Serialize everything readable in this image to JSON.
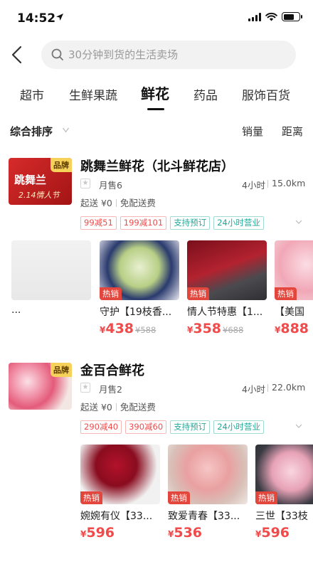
{
  "status_bar": {
    "time": "14:52"
  },
  "search": {
    "placeholder": "30分钟到货的生活卖场"
  },
  "tabs": [
    {
      "label": "超市"
    },
    {
      "label": "生鲜果蔬"
    },
    {
      "label": "鲜花"
    },
    {
      "label": "药品"
    },
    {
      "label": "服饰百货"
    }
  ],
  "active_tab": "鲜花",
  "sort": {
    "main": "综合排序",
    "sales": "销量",
    "distance": "距离"
  },
  "shops": [
    {
      "name": "跳舞兰鲜花（北斗鲜花店）",
      "badge": "品牌",
      "logo_text": "跳舞兰",
      "logo_sub": "2.14情人节",
      "monthly_sales": "月售6",
      "delivery_time": "4小时",
      "distance": "15.0km",
      "delivery_min": "起送 ¥0",
      "delivery_fee": "免配送费",
      "tags": [
        "99减51",
        "199减101",
        "支持预订",
        "24小时营业"
      ],
      "products": [
        {
          "name": "...",
          "price": "",
          "orig": ""
        },
        {
          "name": "守护【19枝香...",
          "hot": "热销",
          "yen": "¥",
          "price": "438",
          "orig": "¥588"
        },
        {
          "name": "情人节特惠【1...",
          "hot": "热销",
          "yen": "¥",
          "price": "358",
          "orig": "¥688"
        },
        {
          "name": "【美国",
          "hot": "热销",
          "yen": "¥",
          "price": "888",
          "orig": ""
        }
      ]
    },
    {
      "name": "金百合鲜花",
      "badge": "品牌",
      "monthly_sales": "月售2",
      "delivery_time": "4小时",
      "distance": "22.0km",
      "delivery_min": "起送 ¥0",
      "delivery_fee": "免配送费",
      "tags": [
        "290减40",
        "390减60",
        "支持预订",
        "24小时营业"
      ],
      "products": [
        {
          "name": "婉婉有仪【33...",
          "hot": "热销",
          "yen": "¥",
          "price": "596"
        },
        {
          "name": "致爱青春【33...",
          "hot": "热销",
          "yen": "¥",
          "price": "536"
        },
        {
          "name": "三世【33枝",
          "hot": "热销",
          "yen": "¥",
          "price": "596"
        }
      ]
    }
  ],
  "colors": {
    "price_red": "#f04a4a",
    "tag_teal": "#20a89a",
    "hot_red": "#e2463c",
    "brand_yellow": "#f7d25a"
  }
}
